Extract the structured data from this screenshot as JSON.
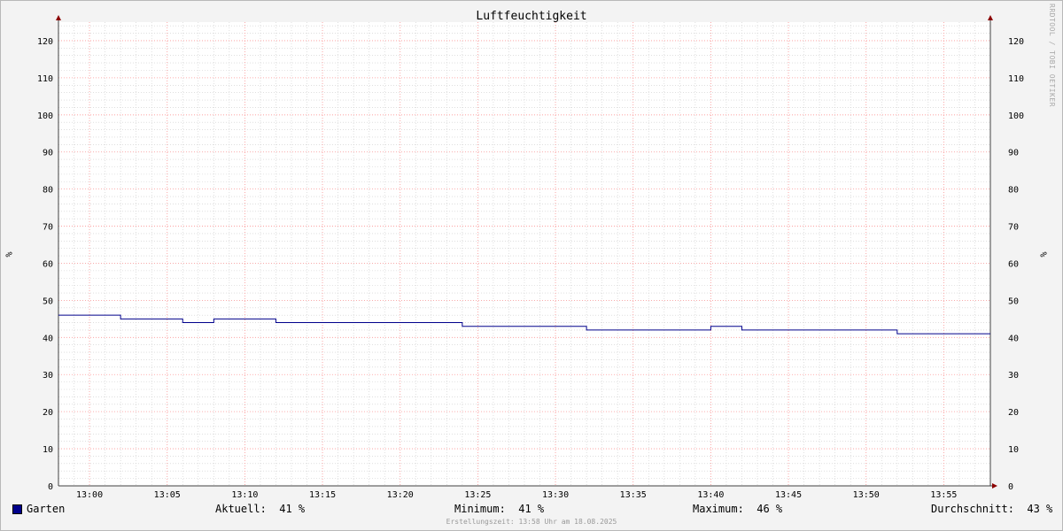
{
  "chart_data": {
    "type": "line",
    "title": "Luftfeuchtigkeit",
    "ylabel": "%",
    "ylim": [
      0,
      125
    ],
    "yticks": [
      0,
      10,
      20,
      30,
      40,
      50,
      60,
      70,
      80,
      90,
      100,
      110,
      120
    ],
    "xlim": [
      "12:58",
      "13:58"
    ],
    "xticks": [
      "13:00",
      "13:05",
      "13:10",
      "13:15",
      "13:20",
      "13:25",
      "13:30",
      "13:35",
      "13:40",
      "13:45",
      "13:50",
      "13:55"
    ],
    "grid": true,
    "series": [
      {
        "name": "Garten",
        "color": "#00008b",
        "x": [
          "12:58",
          "13:02",
          "13:06",
          "13:08",
          "13:12",
          "13:24",
          "13:32",
          "13:40",
          "13:42",
          "13:52",
          "13:58"
        ],
        "y": [
          46,
          45,
          44,
          45,
          44,
          43,
          42,
          43,
          42,
          41,
          41
        ]
      }
    ]
  },
  "watermark": "RRDTOOL / TOBI OETIKER",
  "legend": {
    "series_label": "Garten",
    "current": "Aktuell:  41 %",
    "minimum": "Minimum:  41 %",
    "maximum": "Maximum:  46 %",
    "average": "Durchschnitt:  43 %"
  },
  "footer": "Erstellungszeit: 13:58 Uhr am 18.08.2025",
  "colors": {
    "major_grid": "#ff9999",
    "minor_grid": "#cccccc",
    "axis": "#404040",
    "arrow": "#8b0000"
  }
}
